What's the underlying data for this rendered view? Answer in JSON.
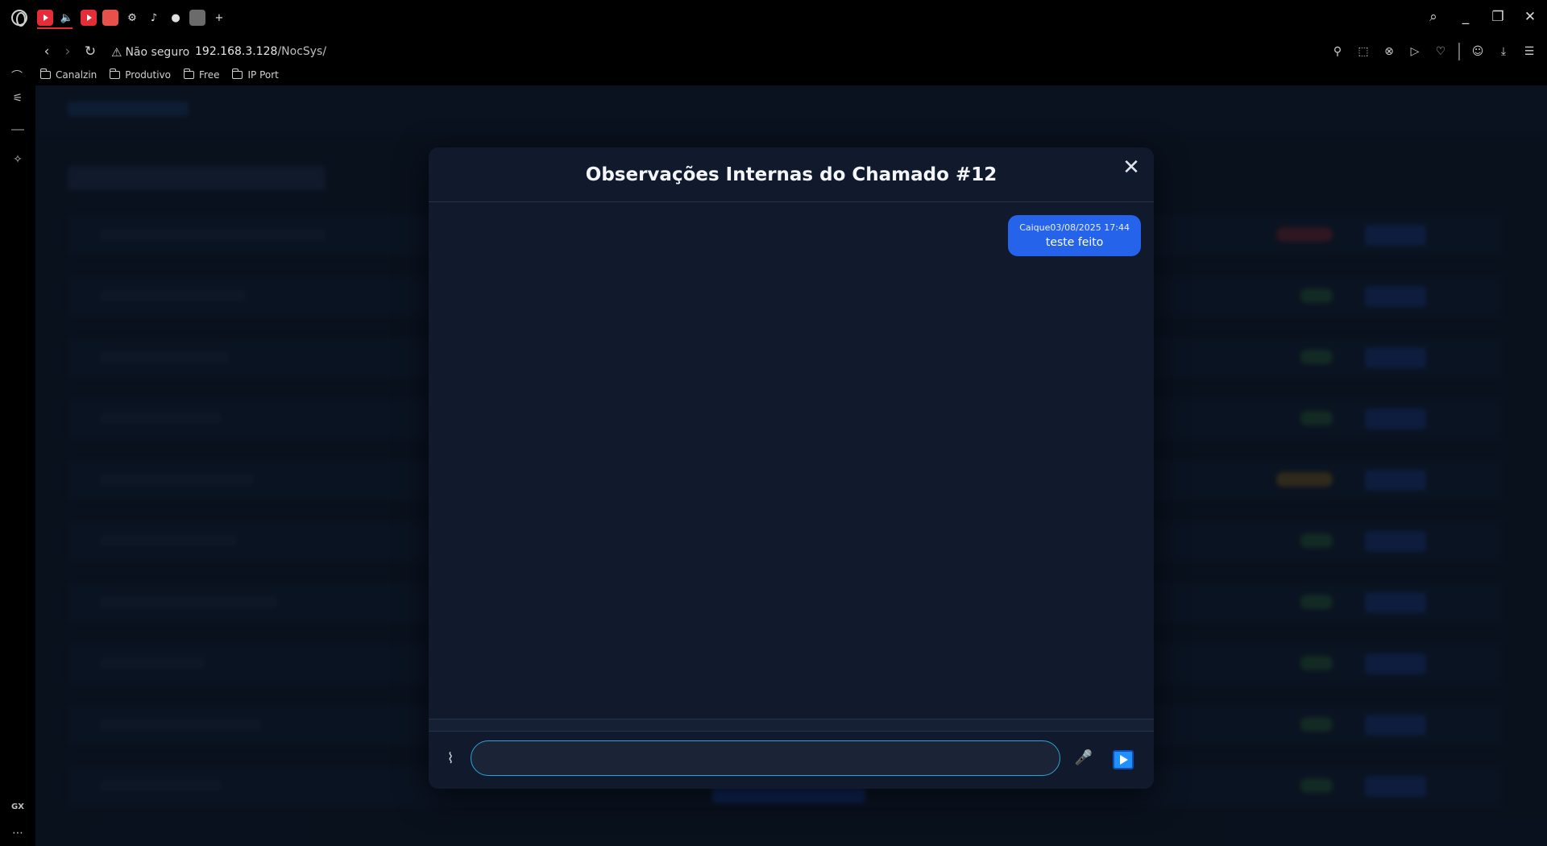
{
  "browser": {
    "security_label": "Não seguro",
    "url_host": "192.168.3.128",
    "url_path": "/NocSys/",
    "bookmarks": [
      {
        "label": "Canalzin"
      },
      {
        "label": "Produtivo"
      },
      {
        "label": "Free"
      },
      {
        "label": "IP Port"
      }
    ],
    "sidebar_bottom_label": "GX"
  },
  "modal": {
    "title": "Observações Internas do Chamado #12",
    "close_symbol": "✕",
    "messages": [
      {
        "author": "Caique",
        "timestamp": "03/08/2025 17:44",
        "text": "teste feito"
      }
    ],
    "composer": {
      "input_value": "",
      "input_placeholder": ""
    }
  },
  "colors": {
    "accent": "#2563eb",
    "page_bg": "#0e1626",
    "modal_bg": "#111a2c",
    "input_border": "#2aa4d8"
  }
}
